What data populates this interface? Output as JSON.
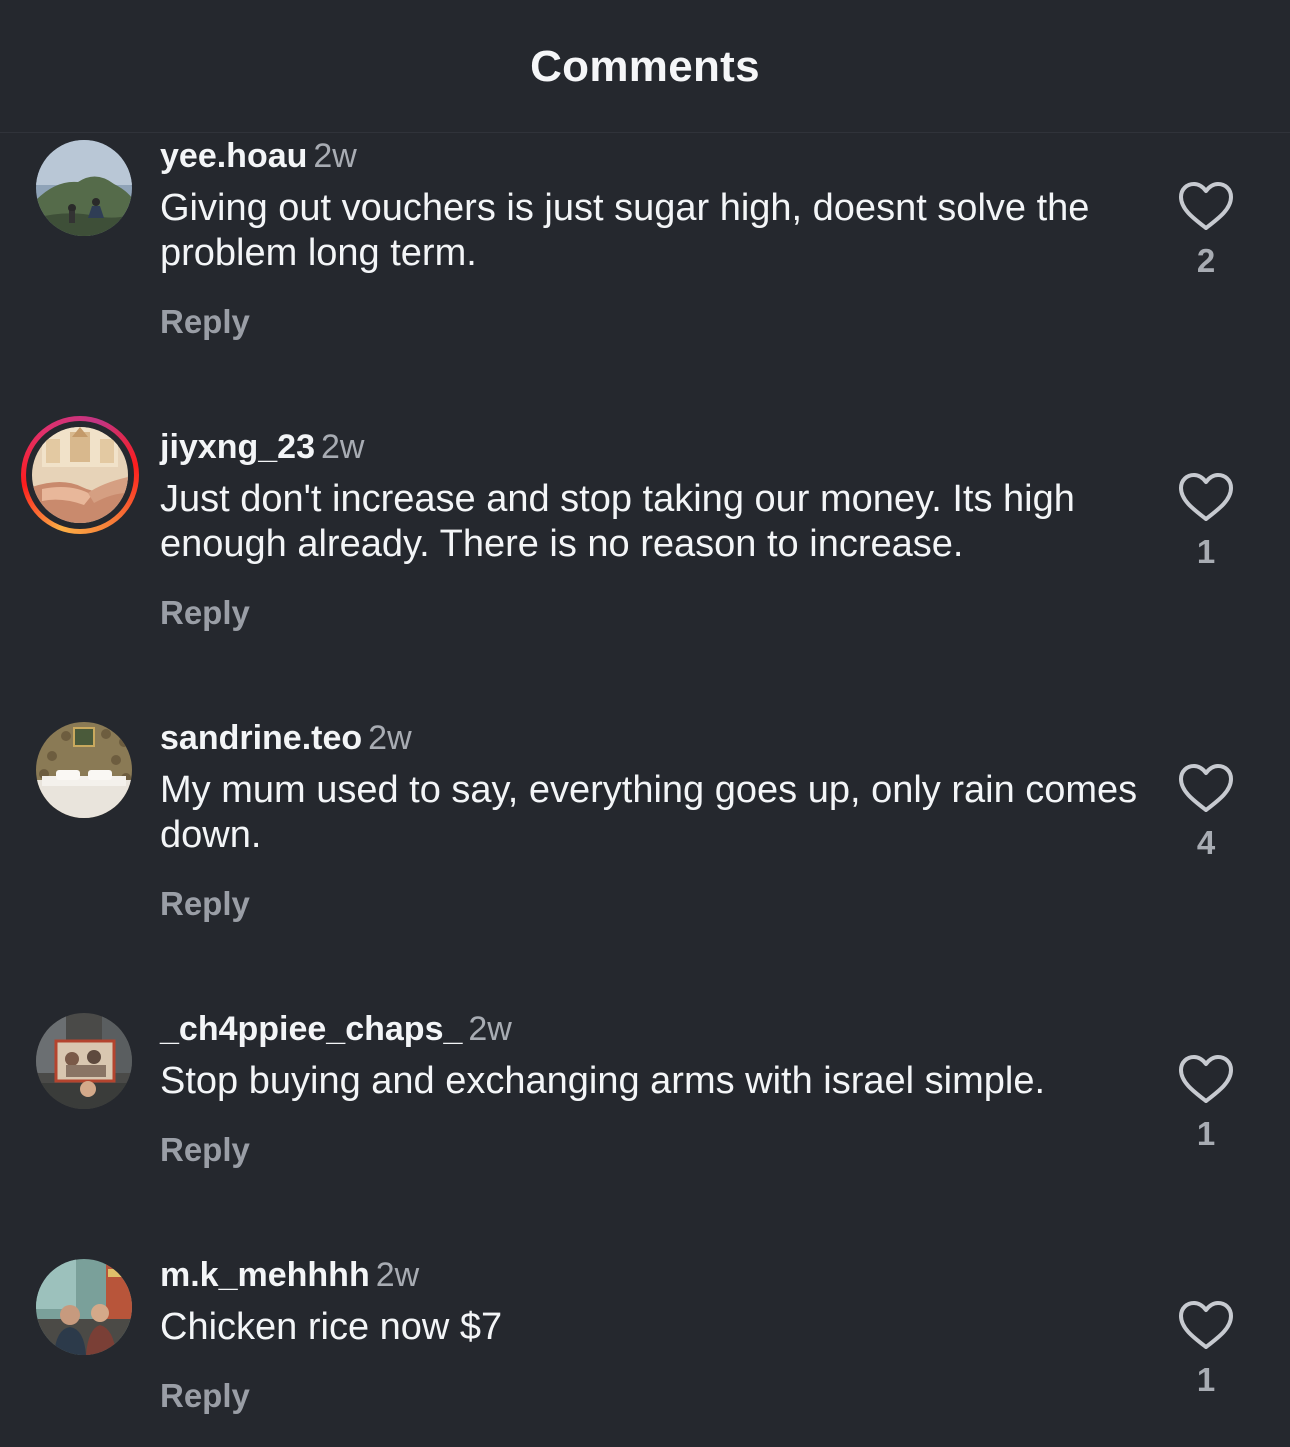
{
  "header": {
    "title": "Comments"
  },
  "comments": [
    {
      "username": "yee.hoau",
      "time": "2w",
      "text": "Giving out vouchers is just sugar high, doesnt solve the problem long term.",
      "reply": "Reply",
      "likes": "2",
      "has_story_ring": false
    },
    {
      "username": "jiyxng_23",
      "time": "2w",
      "text": "Just don't increase and stop taking our money. Its high enough already. There is no reason to increase.",
      "reply": "Reply",
      "likes": "1",
      "has_story_ring": true
    },
    {
      "username": "sandrine.teo",
      "time": "2w",
      "text": "My mum used to say, everything goes up, only rain comes down.",
      "reply": "Reply",
      "likes": "4",
      "has_story_ring": false
    },
    {
      "username": "_ch4ppiee_chaps_",
      "time": "2w",
      "text": "Stop buying and exchanging arms with israel simple.",
      "reply": "Reply",
      "likes": "1",
      "has_story_ring": false
    },
    {
      "username": "m.k_mehhhh",
      "time": "2w",
      "text": "Chicken rice now $7",
      "reply": "Reply",
      "likes": "1",
      "has_story_ring": false
    }
  ],
  "icons": {
    "like": "heart-outline-icon"
  },
  "colors": {
    "background": "#25282e",
    "text": "#f3f5f7",
    "secondary_text": "#a8acb3",
    "reply_text": "#9a9ea6",
    "story_ring": [
      "#fcaf45",
      "#fd1d1d",
      "#e1306c",
      "#c13584"
    ]
  }
}
